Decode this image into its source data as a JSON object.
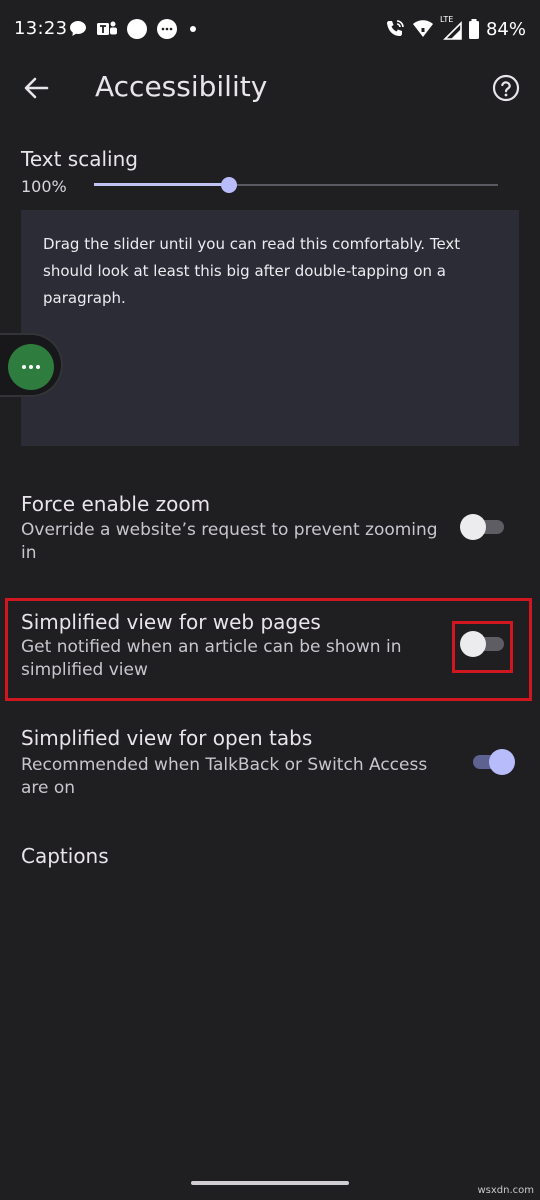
{
  "status_bar": {
    "time": "13:23",
    "battery": "84%",
    "network_type": "LTE",
    "left_icons": [
      "chat-bubble-icon",
      "teams-icon",
      "circle-app-icon",
      "messages-icon",
      "dot-icon"
    ],
    "right_icons": [
      "wifi-calling-icon",
      "wifi-icon",
      "signal-icon",
      "battery-icon"
    ]
  },
  "app_bar": {
    "title": "Accessibility",
    "back_icon": "arrow-back-icon",
    "help_icon": "help-circle-icon"
  },
  "text_scaling": {
    "title": "Text scaling",
    "value_label": "100%",
    "slider_fraction": 0.335,
    "preview_text": "Drag the slider until you can read this comfortably. Text should look at least this big after double-tapping on a paragraph."
  },
  "settings": {
    "force_zoom": {
      "title": "Force enable zoom",
      "description": "Override a website’s request to prevent zooming in",
      "enabled": false
    },
    "simplified_web": {
      "title": "Simplified view for web pages",
      "description": "Get notified when an article can be shown in simplified view",
      "enabled": false
    },
    "simplified_tabs": {
      "title": "Simplified view for open tabs",
      "description": "Recommended when TalkBack or Switch Access are on",
      "enabled": true
    },
    "captions": {
      "title": "Captions"
    }
  },
  "watermark": "wsxdn.com",
  "colors": {
    "background": "#1f1f22",
    "accent": "#b9bcfa",
    "highlight": "#d0161f",
    "preview_background": "#2c2c36",
    "bubble_green": "#2e7d3f"
  }
}
